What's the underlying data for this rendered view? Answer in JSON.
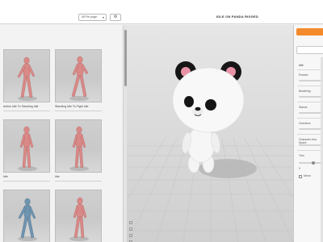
{
  "toolbar": {
    "per_page": "48 Per page",
    "settings_icon": "gear-icon",
    "character_title": "IDLE ON PANDA RIGGED"
  },
  "gallery": {
    "cards": [
      {
        "label": "Action Idle To Standing Idle",
        "tint": "#d98a88"
      },
      {
        "label": "Standing Idle To Fight Idle",
        "tint": "#d98a88"
      },
      {
        "label": "Idle",
        "tint": "#d98a88"
      },
      {
        "label": "Idle",
        "tint": "#d98a88"
      },
      {
        "label": "",
        "tint": "#6f94b0"
      },
      {
        "label": "",
        "tint": "#d98a88"
      }
    ]
  },
  "viewport": {
    "model": "panda-bear-character",
    "floor_color": "#d4d4d4"
  },
  "panel": {
    "title": "Idle",
    "params": [
      {
        "label": "Posture",
        "level": 1.0
      },
      {
        "label": "Breathing",
        "level": 1.0
      },
      {
        "label": "Stance",
        "level": 1.0
      },
      {
        "label": "Overdrive",
        "level": 1.0
      },
      {
        "label": "Character Arm-Space",
        "level": 1.0
      },
      {
        "label": "Trim",
        "level": 0.5
      }
    ],
    "trim_value": "0",
    "mirror_label": "Mirror",
    "colors": {
      "accent": "#f58a2c"
    }
  }
}
